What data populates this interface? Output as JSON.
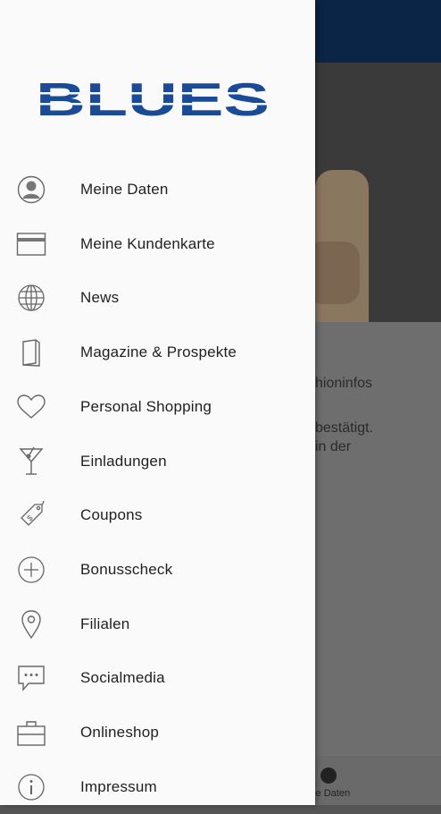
{
  "brand": {
    "logo_text": "BLUES",
    "logo_color": "#1b4a96"
  },
  "colors": {
    "header_bg": "#0b2546",
    "drawer_bg": "#fafafa",
    "text": "#1f1f1f",
    "icon": "#666666"
  },
  "menu": {
    "items": [
      {
        "label": "Meine Daten",
        "icon": "person-icon"
      },
      {
        "label": "Meine Kundenkarte",
        "icon": "card-icon"
      },
      {
        "label": "News",
        "icon": "globe-icon"
      },
      {
        "label": "Magazine & Prospekte",
        "icon": "magazine-icon"
      },
      {
        "label": "Personal Shopping",
        "icon": "heart-icon"
      },
      {
        "label": "Einladungen",
        "icon": "cocktail-glass-icon"
      },
      {
        "label": "Coupons",
        "icon": "price-tag-icon"
      },
      {
        "label": "Bonusscheck",
        "icon": "plus-circle-icon"
      },
      {
        "label": "Filialen",
        "icon": "location-pin-icon"
      },
      {
        "label": "Socialmedia",
        "icon": "chat-bubble-icon"
      },
      {
        "label": "Onlineshop",
        "icon": "shopping-bag-icon"
      },
      {
        "label": "Impressum",
        "icon": "info-icon"
      }
    ]
  },
  "background": {
    "text_line1": "hioninfos",
    "text_line2": "bestätigt.",
    "text_line3": "in der",
    "bottom_nav_label": "ine Daten"
  }
}
